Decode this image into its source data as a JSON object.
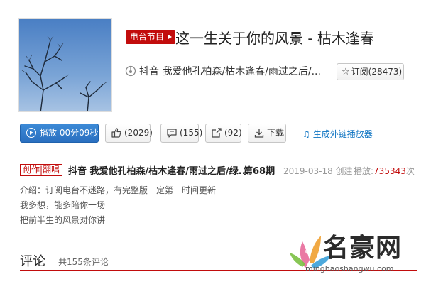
{
  "header": {
    "badge": "电台节目",
    "title": "这一生关于你的风景 - 枯木逢春",
    "creator": "抖音 我爱他孔柏森/枯木逢春/雨过之后/...",
    "subscribe_label": "订阅(28473)"
  },
  "actions": {
    "play_label": "播放 00分09秒",
    "like_label": "(2029)",
    "comment_label": "(155)",
    "share_label": "(92)",
    "download_label": "下载",
    "external_player_label": "生成外链播放器"
  },
  "program": {
    "category": "创作|翻唱",
    "title": "抖音 我爱他孔柏森/枯木逢春/雨过之后/绿...",
    "episode": "第68期",
    "date": "2019-03-18 创建",
    "plays_label": "播放:",
    "plays_value": "735343",
    "plays_unit": "次"
  },
  "description": {
    "line1": "介绍：订阅电台不迷路，有完整版一定第一时间更新",
    "line2": "我多想，能多陪你一场",
    "line3": "把前半生的风景对你讲"
  },
  "comments": {
    "heading": "评论",
    "count": "共155条评论"
  },
  "watermark": {
    "brand": "名豪网",
    "url": "minghaoshangwu.com"
  },
  "colors": {
    "accent_red": "#c20c0c",
    "play_blue": "#2a6fc0",
    "link_blue": "#0c73c2"
  },
  "icons": {
    "creator": "radio-icon",
    "subscribe": "star-icon",
    "play": "play-icon",
    "like": "thumbs-up-icon",
    "comment": "comment-icon",
    "share": "share-icon",
    "download": "download-icon",
    "external": "music-note-icon"
  }
}
